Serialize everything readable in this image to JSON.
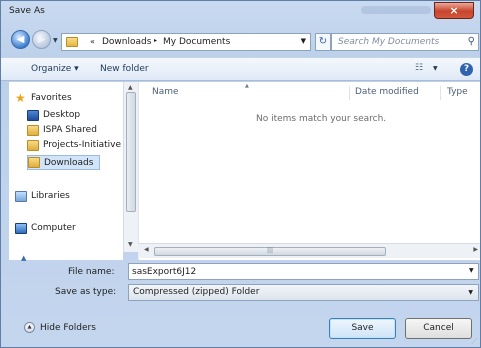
{
  "window": {
    "title": "Save As",
    "close_glyph": "×"
  },
  "address": {
    "overflow": "«",
    "crumbs": [
      "Downloads",
      "My Documents"
    ],
    "separator": "▸",
    "search_placeholder": "Search My Documents"
  },
  "toolbar": {
    "organize": "Organize ▾",
    "new_folder": "New folder"
  },
  "nav": {
    "items": [
      {
        "label": "Favorites",
        "icon": "star-icon"
      },
      {
        "label": "Desktop",
        "icon": "desktop-icon"
      },
      {
        "label": "ISPA Shared",
        "icon": "folder-icon"
      },
      {
        "label": "Projects-Initiative",
        "icon": "folder-icon"
      },
      {
        "label": "Downloads",
        "icon": "downloads-folder-icon",
        "selected": true
      },
      {
        "label": "Libraries",
        "icon": "libraries-icon"
      },
      {
        "label": "Computer",
        "icon": "computer-icon"
      }
    ]
  },
  "files": {
    "columns": [
      "Name",
      "Date modified",
      "Type"
    ],
    "empty_message": "No items match your search."
  },
  "form": {
    "filename_label": "File name:",
    "filename_value": "sasExport6J12",
    "savetype_label": "Save as type:",
    "savetype_value": "Compressed (zipped) Folder"
  },
  "buttons": {
    "hide_folders": "Hide Folders",
    "save": "Save",
    "cancel": "Cancel"
  },
  "colors": {
    "accent": "#3c7fb1",
    "frame": "#bcd0ea",
    "close": "#c7442c"
  }
}
